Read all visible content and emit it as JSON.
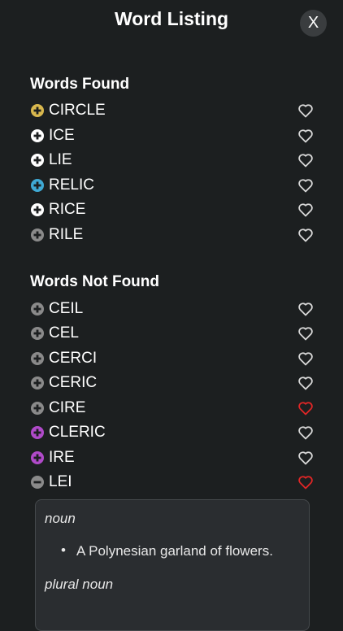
{
  "header": {
    "title": "Word Listing",
    "close_label": "X"
  },
  "colors": {
    "icon_yellow": "#d9b84e",
    "icon_white": "#ffffff",
    "icon_blue": "#3fa9d4",
    "icon_gray": "#8a8a8a",
    "icon_purple": "#b04ac9",
    "heart_outline": "#d8d8d8",
    "heart_red": "#e02626"
  },
  "found": {
    "title": "Words Found",
    "words": [
      {
        "word": "CIRCLE",
        "icon": "plus-circle-yellow-icon",
        "heart": "heart-outline-icon"
      },
      {
        "word": "ICE",
        "icon": "plus-circle-white-icon",
        "heart": "heart-outline-icon"
      },
      {
        "word": "LIE",
        "icon": "plus-circle-white-icon",
        "heart": "heart-outline-icon"
      },
      {
        "word": "RELIC",
        "icon": "plus-circle-blue-icon",
        "heart": "heart-outline-icon"
      },
      {
        "word": "RICE",
        "icon": "plus-circle-white-icon",
        "heart": "heart-outline-icon"
      },
      {
        "word": "RILE",
        "icon": "plus-circle-gray-icon",
        "heart": "heart-outline-icon"
      }
    ]
  },
  "not_found": {
    "title": "Words Not Found",
    "words": [
      {
        "word": "CEIL",
        "icon": "plus-circle-gray-icon",
        "heart": "heart-outline-icon"
      },
      {
        "word": "CEL",
        "icon": "plus-circle-gray-icon",
        "heart": "heart-outline-icon"
      },
      {
        "word": "CERCI",
        "icon": "plus-circle-gray-icon",
        "heart": "heart-outline-icon"
      },
      {
        "word": "CERIC",
        "icon": "plus-circle-gray-icon",
        "heart": "heart-outline-icon"
      },
      {
        "word": "CIRE",
        "icon": "plus-circle-gray-icon",
        "heart": "heart-red-icon"
      },
      {
        "word": "CLERIC",
        "icon": "plus-circle-purple-icon",
        "heart": "heart-outline-icon"
      },
      {
        "word": "IRE",
        "icon": "plus-circle-purple-icon",
        "heart": "heart-outline-icon"
      },
      {
        "word": "LEI",
        "icon": "minus-circle-gray-icon",
        "heart": "heart-red-icon"
      }
    ]
  },
  "definition": {
    "pos1": "noun",
    "items": [
      "A Polynesian garland of flowers."
    ],
    "pos2": "plural noun"
  }
}
